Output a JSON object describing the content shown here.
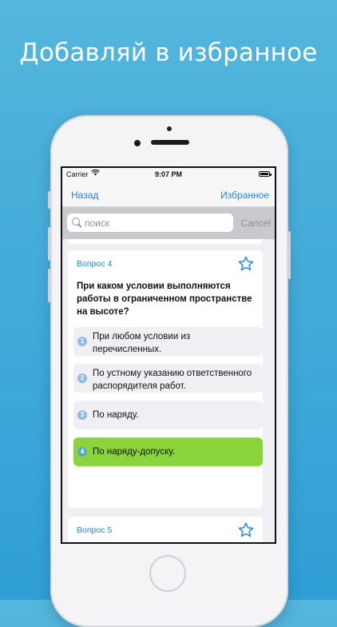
{
  "headline": "Добавляй в избранное",
  "status_bar": {
    "carrier": "Carrier",
    "wifi_icon": "wifi-icon",
    "time": "9:07 PM",
    "battery_icon": "battery-icon"
  },
  "nav": {
    "back": "Назад",
    "favorites": "Избранное"
  },
  "search": {
    "placeholder": "поиск",
    "cancel": "Cancel"
  },
  "questions": [
    {
      "number": "Вопрос 4",
      "text": "При каком условии выполняются работы в ограниченном пространстве на высоте?",
      "favorite_icon": "star-outline-icon",
      "answers": [
        {
          "index": "1",
          "text": "При любом условии из перечисленных.",
          "correct": false
        },
        {
          "index": "2",
          "text": "По устному указанию ответственного распорядителя работ.",
          "correct": false
        },
        {
          "index": "3",
          "text": "По наряду.",
          "correct": false
        },
        {
          "index": "4",
          "text": "По наряду-допуску.",
          "correct": true
        }
      ]
    },
    {
      "number": "Вопрос 5",
      "favorite_icon": "star-outline-icon"
    }
  ],
  "colors": {
    "background_top": "#54b6dc",
    "background_bottom": "#2f9fd6",
    "accent": "#1e82f0",
    "correct": "#8bd43c",
    "badge": "#8fbde8"
  }
}
